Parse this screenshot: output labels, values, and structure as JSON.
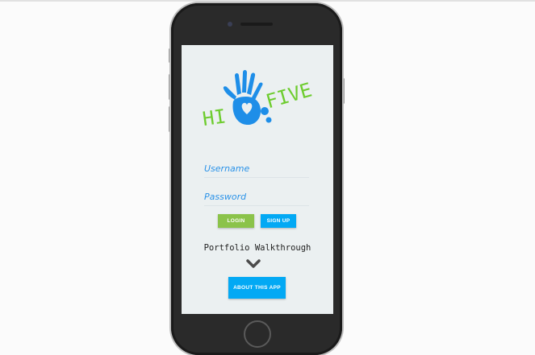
{
  "screen": {
    "logo": {
      "text_left": "HI",
      "text_right": "FIVE",
      "colors": {
        "green": "#6dcc2e",
        "blue": "#1e8ee8"
      }
    },
    "username": {
      "placeholder": "Username",
      "value": ""
    },
    "password": {
      "placeholder": "Password",
      "value": ""
    },
    "login_label": "LOGIN",
    "signup_label": "SIGN UP",
    "walkthrough_label": "Portfolio Walkthrough",
    "chevron_icon": "chevron-down-icon",
    "about_label": "ABOUT THIS APP"
  },
  "colors": {
    "login": "#8bc34a",
    "signup": "#03a9f4",
    "about": "#03a9f4"
  }
}
